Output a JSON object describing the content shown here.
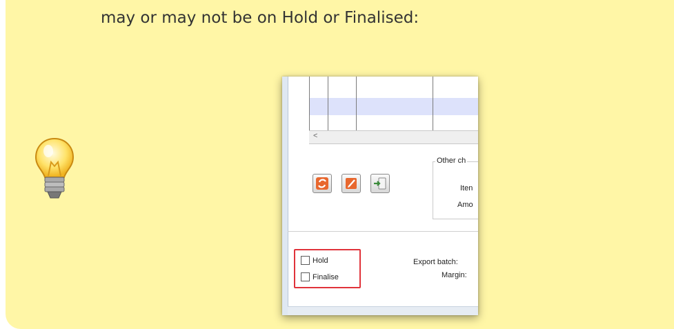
{
  "note": {
    "text": "may or may not be on Hold or Finalised:",
    "icon": "lightbulb-icon",
    "background": "#fff6a6"
  },
  "screenshot": {
    "scroll_left_arrow": "<",
    "other_charges_legend": "Other ch",
    "other_charges_rows": [
      "Iten",
      "Amo"
    ],
    "toolbar_icons": [
      "refresh-icon",
      "edit-icon",
      "add-icon"
    ],
    "hold_label": "Hold",
    "finalise_label": "Finalise",
    "export_batch_label": "Export batch:",
    "margin_label": "Margin:",
    "highlight_color": "#e0323a"
  }
}
